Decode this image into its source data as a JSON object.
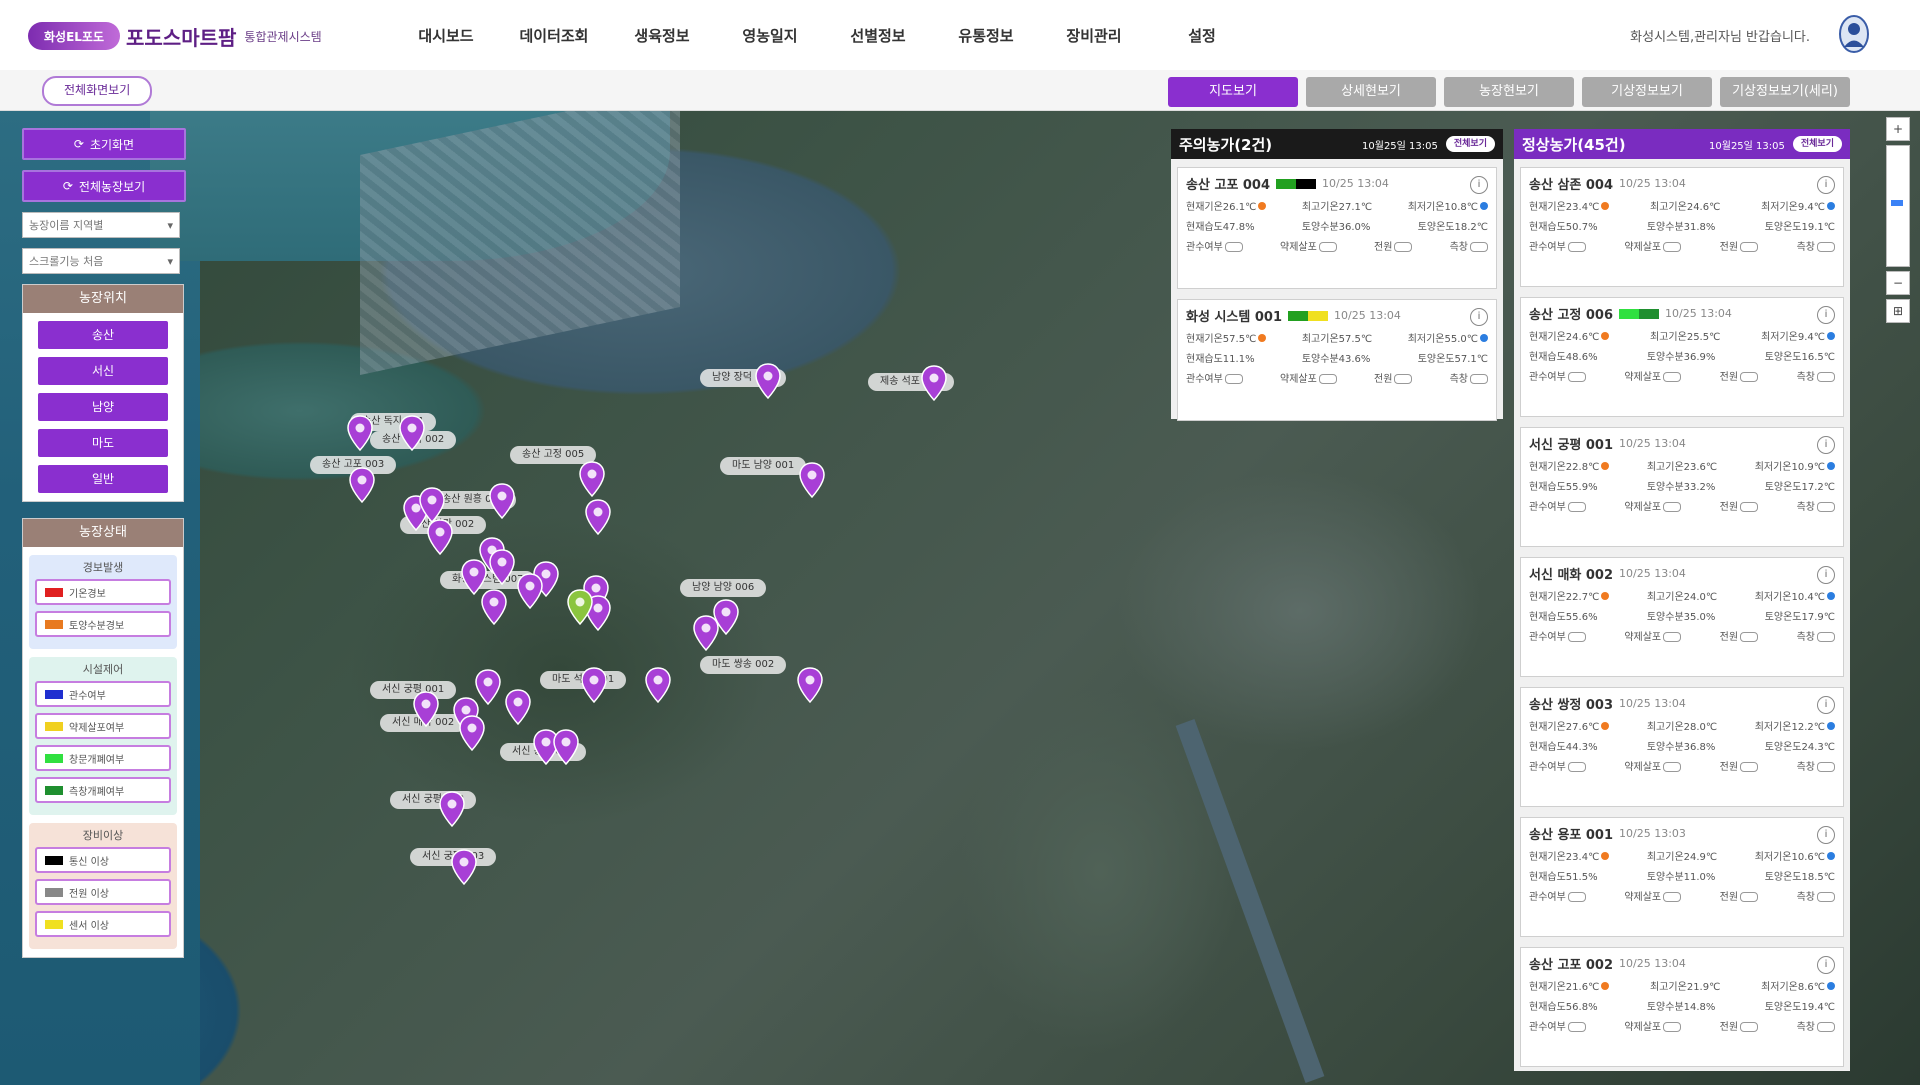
{
  "header": {
    "logo_mark": "화성EL포도",
    "logo_text": "포도스마트팜",
    "logo_sub": "통합관제시스템",
    "nav": [
      "대시보드",
      "데이터조회",
      "생육정보",
      "영농일지",
      "선별정보",
      "유통정보",
      "장비관리",
      "설정"
    ],
    "greeting": "화성시스템,관리자님 반갑습니다."
  },
  "subbar": {
    "fullscreen": "전체화면보기",
    "tabs": [
      "지도보기",
      "상세현보기",
      "농장현보기",
      "기상정보보기",
      "기상정보보기(세리)"
    ]
  },
  "left": {
    "reset_btn": "초기화면",
    "all_farms_btn": "전체농장보기",
    "select1": "농장이름 지역별",
    "select2": "스크롤기능 처음",
    "location_title": "농장위치",
    "regions": [
      "송산",
      "서신",
      "남양",
      "마도",
      "일반"
    ],
    "status_title": "농장상태",
    "groups": [
      {
        "title": "경보발생",
        "bg": "#dfe9fb",
        "items": [
          {
            "label": "기온경보",
            "color": "#e02020"
          },
          {
            "label": "토양수분경보",
            "color": "#e87a20"
          }
        ]
      },
      {
        "title": "시설제어",
        "bg": "#dff3ee",
        "items": [
          {
            "label": "관수여부",
            "color": "#1f2fd0"
          },
          {
            "label": "약제살포여부",
            "color": "#f0d020"
          },
          {
            "label": "창문개폐여부",
            "color": "#30e040"
          },
          {
            "label": "측창개폐여부",
            "color": "#1f8f2f"
          }
        ]
      },
      {
        "title": "장비이상",
        "bg": "#f6e2d8",
        "items": [
          {
            "label": "통신 이상",
            "color": "#000000"
          },
          {
            "label": "전원 이상",
            "color": "#888888"
          },
          {
            "label": "센서 이상",
            "color": "#f0e020"
          }
        ]
      }
    ]
  },
  "map": {
    "labels": [
      {
        "text": "남양 장덕 007"
      },
      {
        "text": "제송 석포 001"
      },
      {
        "text": "송산 독지 001"
      },
      {
        "text": "송산 독지 002"
      },
      {
        "text": "송산 고포 003"
      },
      {
        "text": "송산 고정 005"
      },
      {
        "text": "마도 남양 001"
      },
      {
        "text": "송산 원흥 001"
      },
      {
        "text": "송산 사강 002"
      },
      {
        "text": "화성 시스템 007"
      },
      {
        "text": "남양 남양 006"
      },
      {
        "text": "마도 쌍송 002"
      },
      {
        "text": "마도 석교 001"
      },
      {
        "text": "서신 궁평 001"
      },
      {
        "text": "서신 매화 002"
      },
      {
        "text": "서신 홍법 001"
      },
      {
        "text": "서신 궁평 002"
      },
      {
        "text": "서신 궁평 003"
      }
    ]
  },
  "warn_panel": {
    "title": "주의농가(2건)",
    "time": "10월25일 13:05",
    "button": "전체보기",
    "cards": [
      {
        "name": "송산 고포 004",
        "time": "10/25 13:04",
        "r1": [
          "현재기온26.1℃",
          "최고기온27.1℃",
          "최저기온10.8℃"
        ],
        "r2": [
          "현재습도47.8%",
          "토양수분36.0%",
          "토양온도18.2℃"
        ],
        "r3": [
          "관수여부",
          "약제살포",
          "전원",
          "측창"
        ],
        "bar": [
          "#22a020",
          "#000000"
        ]
      },
      {
        "name": "화성 시스템 001",
        "time": "10/25 13:04",
        "r1": [
          "현재기온57.5℃",
          "최고기온57.5℃",
          "최저기온55.0℃"
        ],
        "r2": [
          "현재습도11.1%",
          "토양수분43.6%",
          "토양온도57.1℃"
        ],
        "r3": [
          "관수여부",
          "약제살포",
          "전원",
          "측창"
        ],
        "bar": [
          "#22a020",
          "#f0e020"
        ]
      }
    ]
  },
  "normal_panel": {
    "title": "정상농가(45건)",
    "time": "10월25일 13:05",
    "button": "전체보기",
    "cards": [
      {
        "name": "송산 삼존 004",
        "time": "10/25 13:04",
        "r1": [
          "현재기온23.4℃",
          "최고기온24.6℃",
          "최저기온9.4℃"
        ],
        "r2": [
          "현재습도50.7%",
          "토양수분31.8%",
          "토양온도19.1℃"
        ],
        "r3": [
          "관수여부",
          "약제살포",
          "전원",
          "측창"
        ]
      },
      {
        "name": "송산 고정 006",
        "time": "10/25 13:04",
        "r1": [
          "현재기온24.6℃",
          "최고기온25.5℃",
          "최저기온9.4℃"
        ],
        "r2": [
          "현재습도48.6%",
          "토양수분36.9%",
          "토양온도16.5℃"
        ],
        "r3": [
          "관수여부",
          "약제살포",
          "전원",
          "측창"
        ],
        "bar": [
          "#30e040",
          "#1f8f2f"
        ]
      },
      {
        "name": "서신 궁평 001",
        "time": "10/25 13:04",
        "r1": [
          "현재기온22.8℃",
          "최고기온23.6℃",
          "최저기온10.9℃"
        ],
        "r2": [
          "현재습도55.9%",
          "토양수분33.2%",
          "토양온도17.2℃"
        ],
        "r3": [
          "관수여부",
          "약제살포",
          "전원",
          "측창"
        ]
      },
      {
        "name": "서신 매화 002",
        "time": "10/25 13:04",
        "r1": [
          "현재기온22.7℃",
          "최고기온24.0℃",
          "최저기온10.4℃"
        ],
        "r2": [
          "현재습도55.6%",
          "토양수분35.0%",
          "토양온도17.9℃"
        ],
        "r3": [
          "관수여부",
          "약제살포",
          "전원",
          "측창"
        ]
      },
      {
        "name": "송산 쌍정 003",
        "time": "10/25 13:04",
        "r1": [
          "현재기온27.6℃",
          "최고기온28.0℃",
          "최저기온12.2℃"
        ],
        "r2": [
          "현재습도44.3%",
          "토양수분36.8%",
          "토양온도24.3℃"
        ],
        "r3": [
          "관수여부",
          "약제살포",
          "전원",
          "측창"
        ]
      },
      {
        "name": "송산 용포 001",
        "time": "10/25 13:03",
        "r1": [
          "현재기온23.4℃",
          "최고기온24.9℃",
          "최저기온10.6℃"
        ],
        "r2": [
          "현재습도51.5%",
          "토양수분11.0%",
          "토양온도18.5℃"
        ],
        "r3": [
          "관수여부",
          "약제살포",
          "전원",
          "측창"
        ]
      },
      {
        "name": "송산 고포 002",
        "time": "10/25 13:04",
        "r1": [
          "현재기온21.6℃",
          "최고기온21.9℃",
          "최저기온8.6℃"
        ],
        "r2": [
          "현재습도56.8%",
          "토양수분14.8%",
          "토양온도19.4℃"
        ],
        "r3": [
          "관수여부",
          "약제살포",
          "전원",
          "측창"
        ]
      }
    ]
  },
  "colors": {
    "accent": "#8a2fcf",
    "warn_head": "#1a1a1a",
    "normal_head": "#7a2cc0",
    "pin": "#a83fd6",
    "pin_green": "#8bc53f"
  }
}
